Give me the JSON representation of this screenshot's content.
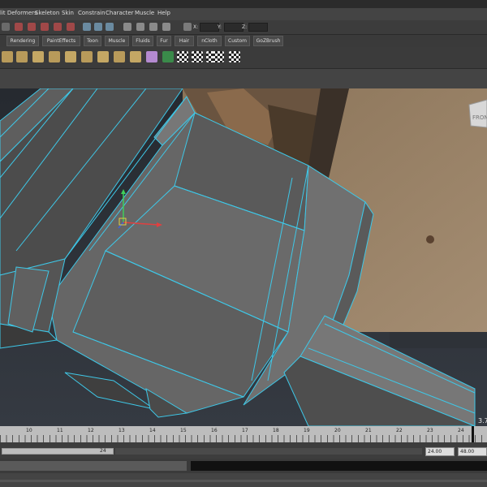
{
  "menu": [
    "lit Deformers",
    "Skeleton",
    "Skin",
    "Constrain",
    "Character",
    "Muscle",
    "Help"
  ],
  "status_line": {
    "x_label": "X:",
    "y_label": "Y:",
    "z_label": "Z:"
  },
  "shelf_tabs": [
    "Rendering",
    "PaintEffects",
    "Toon",
    "Muscle",
    "Fluids",
    "Fur",
    "Hair",
    "nCloth",
    "Custom",
    "GoZBrush"
  ],
  "shelf_icons": [
    "poly-tool-icon",
    "poly-tool-icon",
    "poly-tool-icon",
    "poly-tool-icon",
    "poly-tool-icon",
    "poly-tool-icon",
    "poly-tool-icon",
    "poly-tool-icon",
    "poly-tool-icon",
    "poly-tool-icon",
    "poly-tool-icon",
    "checker-icon",
    "checker-icon",
    "checker-icon",
    "checker-icon",
    "checker-icon"
  ],
  "viewport": {
    "view_cube_label": "FRON",
    "readout": "3.7"
  },
  "timeline": {
    "ticks": [
      "10",
      "11",
      "12",
      "13",
      "14",
      "15",
      "16",
      "17",
      "18",
      "19",
      "20",
      "21",
      "22",
      "23",
      "24"
    ],
    "current_frame": "24"
  },
  "range": {
    "end_value": "24",
    "playback_end": "24.00",
    "animation_end": "48.00"
  },
  "colors": {
    "wireframe": "#3ec8e8",
    "menubar": "#444444",
    "timeline": "#bdbdbd",
    "cmd_bg": "#111111"
  }
}
